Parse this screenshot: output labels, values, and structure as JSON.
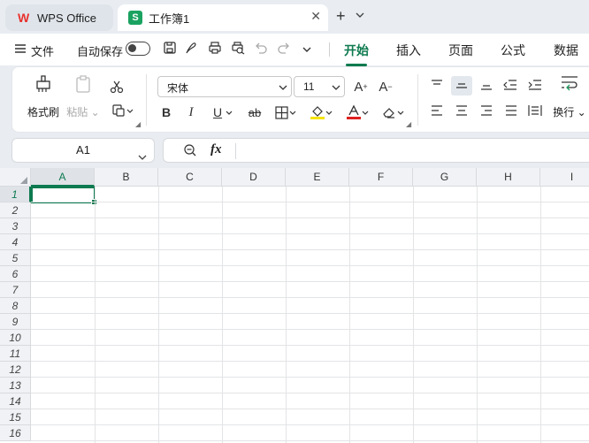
{
  "tabs": {
    "home_tab_label": "WPS Office",
    "document_tab_label": "工作簿1"
  },
  "menubar": {
    "file_label": "文件",
    "autosave_label": "自动保存",
    "ribbon_tabs": [
      "开始",
      "插入",
      "页面",
      "公式",
      "数据"
    ],
    "active_tab": "开始"
  },
  "ribbon": {
    "format_painter_label": "格式刷",
    "paste_label": "粘贴",
    "font_name": "宋体",
    "font_size": "11",
    "wrap_label": "换行"
  },
  "formula_bar": {
    "name_box_value": "A1",
    "fx_label": "fx",
    "formula_value": ""
  },
  "sheet": {
    "columns": [
      "A",
      "B",
      "C",
      "D",
      "E",
      "F",
      "G",
      "H",
      "I"
    ],
    "rows": [
      "1",
      "2",
      "3",
      "4",
      "5",
      "6",
      "7",
      "8",
      "9",
      "10",
      "11",
      "12",
      "13",
      "14",
      "15",
      "16"
    ],
    "selected_cell": "A1"
  },
  "colors": {
    "accent": "#0d7a4f",
    "wps_logo": "#e8322e",
    "sheet_logo": "#1aa260"
  }
}
